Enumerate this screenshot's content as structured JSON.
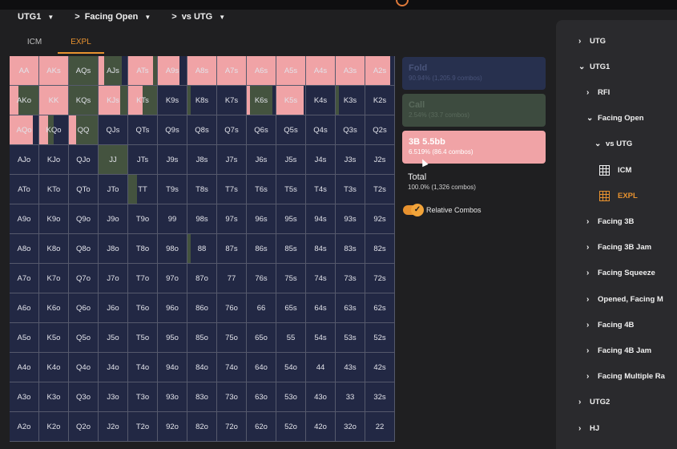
{
  "breadcrumb": [
    {
      "label": "UTG1",
      "chevron": false
    },
    {
      "label": "Facing Open",
      "chevron": true
    },
    {
      "label": "vs UTG",
      "chevron": true
    }
  ],
  "tabs": [
    {
      "label": "ICM",
      "active": false
    },
    {
      "label": "EXPL",
      "active": true
    }
  ],
  "colors": {
    "raise": "#f0a3a6",
    "call": "#44533f",
    "fold": "#222844",
    "accent": "#e8922f"
  },
  "grid": {
    "rows": [
      [
        "AA",
        "AKs",
        "AQs",
        "AJs",
        "ATs",
        "A9s",
        "A8s",
        "A7s",
        "A6s",
        "A5s",
        "A4s",
        "A3s",
        "A2s"
      ],
      [
        "AKo",
        "KK",
        "KQs",
        "KJs",
        "KTs",
        "K9s",
        "K8s",
        "K7s",
        "K6s",
        "K5s",
        "K4s",
        "K3s",
        "K2s"
      ],
      [
        "AQo",
        "KQo",
        "QQ",
        "QJs",
        "QTs",
        "Q9s",
        "Q8s",
        "Q7s",
        "Q6s",
        "Q5s",
        "Q4s",
        "Q3s",
        "Q2s"
      ],
      [
        "AJo",
        "KJo",
        "QJo",
        "JJ",
        "JTs",
        "J9s",
        "J8s",
        "J7s",
        "J6s",
        "J5s",
        "J4s",
        "J3s",
        "J2s"
      ],
      [
        "ATo",
        "KTo",
        "QTo",
        "JTo",
        "TT",
        "T9s",
        "T8s",
        "T7s",
        "T6s",
        "T5s",
        "T4s",
        "T3s",
        "T2s"
      ],
      [
        "A9o",
        "K9o",
        "Q9o",
        "J9o",
        "T9o",
        "99",
        "98s",
        "97s",
        "96s",
        "95s",
        "94s",
        "93s",
        "92s"
      ],
      [
        "A8o",
        "K8o",
        "Q8o",
        "J8o",
        "T8o",
        "98o",
        "88",
        "87s",
        "86s",
        "85s",
        "84s",
        "83s",
        "82s"
      ],
      [
        "A7o",
        "K7o",
        "Q7o",
        "J7o",
        "T7o",
        "97o",
        "87o",
        "77",
        "76s",
        "75s",
        "74s",
        "73s",
        "72s"
      ],
      [
        "A6o",
        "K6o",
        "Q6o",
        "J6o",
        "T6o",
        "96o",
        "86o",
        "76o",
        "66",
        "65s",
        "64s",
        "63s",
        "62s"
      ],
      [
        "A5o",
        "K5o",
        "Q5o",
        "J5o",
        "T5o",
        "95o",
        "85o",
        "75o",
        "65o",
        "55",
        "54s",
        "53s",
        "52s"
      ],
      [
        "A4o",
        "K4o",
        "Q4o",
        "J4o",
        "T4o",
        "94o",
        "84o",
        "74o",
        "64o",
        "54o",
        "44",
        "43s",
        "42s"
      ],
      [
        "A3o",
        "K3o",
        "Q3o",
        "J3o",
        "T3o",
        "93o",
        "83o",
        "73o",
        "63o",
        "53o",
        "43o",
        "33",
        "32s"
      ],
      [
        "A2o",
        "K2o",
        "Q2o",
        "J2o",
        "T2o",
        "92o",
        "82o",
        "72o",
        "62o",
        "52o",
        "42o",
        "32o",
        "22"
      ]
    ],
    "mix": {
      "AA": {
        "raise": 1.0,
        "call": 0
      },
      "AKs": {
        "raise": 1.0,
        "call": 0
      },
      "AQs": {
        "raise": 0,
        "call": 1.0
      },
      "AJs": {
        "raise": 0.2,
        "call": 0.6
      },
      "ATs": {
        "raise": 0.85,
        "call": 0.15
      },
      "A9s": {
        "raise": 0.75,
        "call": 0
      },
      "A8s": {
        "raise": 1.0,
        "call": 0
      },
      "A7s": {
        "raise": 1.0,
        "call": 0
      },
      "A6s": {
        "raise": 1.0,
        "call": 0
      },
      "A5s": {
        "raise": 1.0,
        "call": 0
      },
      "A4s": {
        "raise": 1.0,
        "call": 0
      },
      "A3s": {
        "raise": 1.0,
        "call": 0
      },
      "A2s": {
        "raise": 0.85,
        "call": 0
      },
      "AKo": {
        "raise": 0.3,
        "call": 0.7
      },
      "KK": {
        "raise": 1.0,
        "call": 0
      },
      "KQs": {
        "raise": 0,
        "call": 1.0
      },
      "KJs": {
        "raise": 0.75,
        "call": 0.25
      },
      "KTs": {
        "raise": 0.5,
        "call": 0.5
      },
      "K8s": {
        "raise": 0,
        "call": 0.1
      },
      "K6s": {
        "raise": 0.1,
        "call": 0.8
      },
      "K5s": {
        "raise": 0.95,
        "call": 0
      },
      "K3s": {
        "raise": 0,
        "call": 0.1
      },
      "AQo": {
        "raise": 0.8,
        "call": 0
      },
      "KQo": {
        "raise": 0.3,
        "call": 0.2
      },
      "QQ": {
        "raise": 0.25,
        "call": 0.75
      },
      "JJ": {
        "raise": 0,
        "call": 1.0
      },
      "TT": {
        "raise": 0,
        "call": 0.3
      },
      "88": {
        "raise": 0,
        "call": 0.1
      }
    }
  },
  "actions": [
    {
      "key": "fold",
      "name": "Fold",
      "detail": "90.94% (1,205.9 combos)"
    },
    {
      "key": "call",
      "name": "Call",
      "detail": "2.54% (33.7 combos)"
    },
    {
      "key": "raise",
      "name": "3B 5.5bb",
      "detail": "6.519% (86.4 combos)"
    }
  ],
  "total": {
    "label": "Total",
    "detail": "100.0% (1,326 combos)"
  },
  "relative_combos": {
    "label": "Relative Combos",
    "checked": true
  },
  "tree": [
    {
      "label": "UTG",
      "level": 0,
      "arrow": "right"
    },
    {
      "label": "UTG1",
      "level": 0,
      "arrow": "down"
    },
    {
      "label": "RFI",
      "level": 1,
      "arrow": "right"
    },
    {
      "label": "Facing Open",
      "level": 1,
      "arrow": "down"
    },
    {
      "label": "vs UTG",
      "level": 2,
      "arrow": "down"
    },
    {
      "label": "ICM",
      "level": 3,
      "icon": "grid-icon"
    },
    {
      "label": "EXPL",
      "level": 3,
      "icon": "grid-icon",
      "active": true
    },
    {
      "label": "Facing 3B",
      "level": 1,
      "arrow": "right"
    },
    {
      "label": "Facing 3B Jam",
      "level": 1,
      "arrow": "right"
    },
    {
      "label": "Facing Squeeze",
      "level": 1,
      "arrow": "right"
    },
    {
      "label": "Opened, Facing M",
      "level": 1,
      "arrow": "right"
    },
    {
      "label": "Facing 4B",
      "level": 1,
      "arrow": "right"
    },
    {
      "label": "Facing 4B Jam",
      "level": 1,
      "arrow": "right"
    },
    {
      "label": "Facing Multiple Ra",
      "level": 1,
      "arrow": "right"
    },
    {
      "label": "UTG2",
      "level": 0,
      "arrow": "right"
    },
    {
      "label": "HJ",
      "level": 0,
      "arrow": "right"
    }
  ]
}
